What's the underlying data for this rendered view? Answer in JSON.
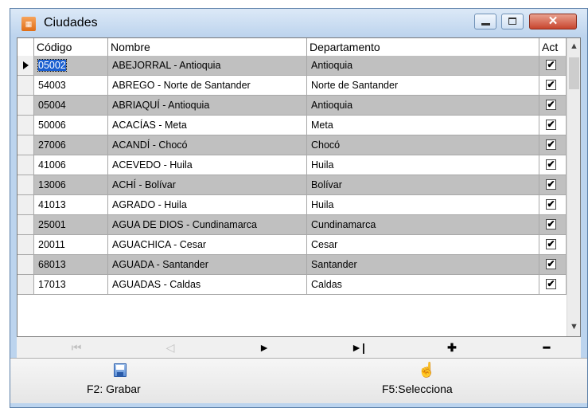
{
  "window": {
    "title": "Ciudades",
    "close_glyph": "✕"
  },
  "grid": {
    "columns": [
      "Código",
      "Nombre",
      "Departamento",
      "Act"
    ],
    "rows": [
      {
        "code": "05002",
        "name": "ABEJORRAL - Antioquia",
        "dept": "Antioquia",
        "active": true
      },
      {
        "code": "54003",
        "name": "ABREGO - Norte de Santander",
        "dept": "Norte de Santander",
        "active": true
      },
      {
        "code": "05004",
        "name": "ABRIAQUÍ - Antioquia",
        "dept": "Antioquia",
        "active": true
      },
      {
        "code": "50006",
        "name": "ACACÍAS - Meta",
        "dept": "Meta",
        "active": true
      },
      {
        "code": "27006",
        "name": "ACANDÍ - Chocó",
        "dept": "Chocó",
        "active": true
      },
      {
        "code": "41006",
        "name": "ACEVEDO - Huila",
        "dept": "Huila",
        "active": true
      },
      {
        "code": "13006",
        "name": "ACHÍ - Bolívar",
        "dept": "Bolívar",
        "active": true
      },
      {
        "code": "41013",
        "name": "AGRADO - Huila",
        "dept": "Huila",
        "active": true
      },
      {
        "code": "25001",
        "name": "AGUA DE DIOS - Cundinamarca",
        "dept": "Cundinamarca",
        "active": true
      },
      {
        "code": "20011",
        "name": "AGUACHICA - Cesar",
        "dept": "Cesar",
        "active": true
      },
      {
        "code": "68013",
        "name": "AGUADA - Santander",
        "dept": "Santander",
        "active": true
      },
      {
        "code": "17013",
        "name": "AGUADAS - Caldas",
        "dept": "Caldas",
        "active": true
      }
    ],
    "current_row": 0
  },
  "navigator": {
    "first": "⏮",
    "prior": "◁",
    "next": "►",
    "last": "►|",
    "insert": "✚",
    "delete": "━"
  },
  "footer": {
    "save_label": "F2: Grabar",
    "select_label": "F5:Selecciona"
  },
  "icons": {
    "app": "app-icon",
    "save": "floppy-disk-icon",
    "select": "hand-pointer-icon"
  }
}
